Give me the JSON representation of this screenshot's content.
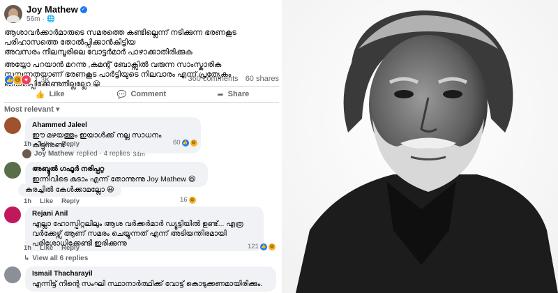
{
  "post": {
    "author": "Joy Mathew",
    "time": "56m",
    "line1": "ആശാവർക്കാർമാരുടെ സമരത്തെ കണ്ടില്ലെന്ന് നടിക്കുന്ന ഭരണകൂട പരിഹാസത്തെ തോൽപ്പിക്കാൻകിട്ടിയ",
    "line2": "അവസരം നിലമ്പൂരിലെ വോട്ടർമാർ പാഴാക്കാതിരിക്കുക",
    "line3": "അയ്യോ പറയാൻ മറന്നു ,കമന്റ് ബോക്സിൽ വരുന്ന സാംസ്കാരിക സമ്പന്നതയാണ് ഭരണകൂട പാർട്ടിയുടെ നിലവാരം എന്ന് പ്രത്യേകം ഓർമ്മിപ്പിക്കേണ്ടതില്ലല്ലോ 😀",
    "reactions": "1.3K",
    "comments": "360 comments",
    "shares": "60 shares"
  },
  "actions": {
    "like": "Like",
    "comment": "Comment",
    "share": "Share"
  },
  "filter": "Most relevant",
  "comments": [
    {
      "name": "Ahammed Jaleel",
      "text": "ഈ മഴയത്തും ഇയാൾക്ക് നല്ല സാധനം കിട്ടുന്നുണ്ട് ...",
      "time": "1h",
      "like": "Like",
      "reply": "Reply",
      "count": "60"
    },
    {
      "name": "Joy Mathew",
      "replied": "replied · 4 replies",
      "time": "34m"
    },
    {
      "name": "അബ്ദുൽ ഗഫൂർ നരിപ്പറ്റ",
      "text1": "ഇന്നിവിടെ കുടാം എന്ന് തോന്നുന്നു Joy Mathew 😆",
      "text2": "കരച്ചിൽ കേൾക്കാമല്ലോ 😆",
      "time": "1h",
      "like": "Like",
      "reply": "Reply",
      "count": "16"
    },
    {
      "name": "Rejani Anil",
      "text": "എല്ലാ ഹോസ്പിറ്റലിലും ആശ വർക്കർമാർ ഡ്യൂട്ടിയിൽ ഉണ്ട്... എത്ര വർക്കേഴ്സ് ആണ് സമരം ചെയ്യുന്നത് എന്ന് അടിയന്തിരമായി പരിശോധിക്കേണ്ടി ഇരിക്കുന്നു",
      "time": "1h",
      "like": "Like",
      "reply": "Reply",
      "count": "121"
    },
    {
      "viewall": "View all 6 replies"
    },
    {
      "name": "Ismail Thacharayil",
      "text": "എന്നിട്ട് നിന്റെ സംഘി സ്ഥാനാർത്ഥിക്ക് വോട്ട് കൊടുക്കണമായിരിക്കും."
    }
  ],
  "colors": {
    "accent": "#1877f2",
    "bubble": "#f0f2f5",
    "muted": "#65676b"
  }
}
